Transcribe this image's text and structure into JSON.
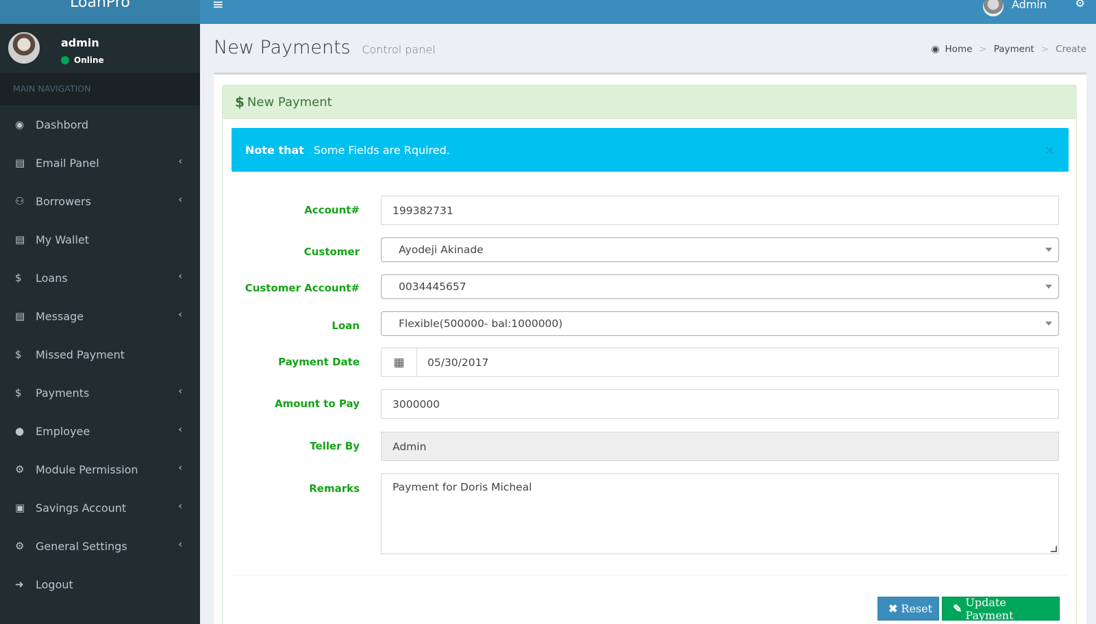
{
  "header": {
    "logo": "LoanPro",
    "menu_icon": "hamburger-icon",
    "user_name": "Admin",
    "settings_icon": "gears-icon"
  },
  "sidebar": {
    "user": {
      "name": "admin",
      "status": "Online",
      "status_color": "#00a65a"
    },
    "nav_header": "MAIN NAVIGATION",
    "items": [
      {
        "label": "Dashbord",
        "icon": "dashboard-icon",
        "glyph": "◉",
        "has_submenu": false
      },
      {
        "label": "Email Panel",
        "icon": "book-icon",
        "glyph": "▤",
        "has_submenu": true
      },
      {
        "label": "Borrowers",
        "icon": "users-icon",
        "glyph": "⚇",
        "has_submenu": true
      },
      {
        "label": "My Wallet",
        "icon": "book-icon",
        "glyph": "▤",
        "has_submenu": false
      },
      {
        "label": "Loans",
        "icon": "dollar-icon",
        "glyph": "$",
        "has_submenu": true
      },
      {
        "label": "Message",
        "icon": "book-icon",
        "glyph": "▤",
        "has_submenu": true
      },
      {
        "label": "Missed Payment",
        "icon": "dollar-icon",
        "glyph": "$",
        "has_submenu": false
      },
      {
        "label": "Payments",
        "icon": "dollar-icon",
        "glyph": "$",
        "has_submenu": true
      },
      {
        "label": "Employee",
        "icon": "user-icon",
        "glyph": "●",
        "has_submenu": true
      },
      {
        "label": "Module Permission",
        "icon": "gears-icon",
        "glyph": "⚙",
        "has_submenu": true
      },
      {
        "label": "Savings Account",
        "icon": "money-icon",
        "glyph": "▣",
        "has_submenu": true
      },
      {
        "label": "General Settings",
        "icon": "gear-icon",
        "glyph": "⚙",
        "has_submenu": true
      },
      {
        "label": "Logout",
        "icon": "sign-out-icon",
        "glyph": "➜",
        "has_submenu": false
      }
    ]
  },
  "page": {
    "title": "New Payments",
    "subtitle": "Control panel",
    "breadcrumb": {
      "home": "Home",
      "section": "Payment",
      "current": "Create"
    }
  },
  "panel": {
    "title": "New Payment",
    "alert": {
      "bold": "Note that",
      "text": "Some Fields are Rquired.",
      "close": "×"
    }
  },
  "form": {
    "account": {
      "label": "Account#",
      "value": "199382731"
    },
    "customer": {
      "label": "Customer",
      "value": "Ayodeji Akinade"
    },
    "customer_account": {
      "label": "Customer Account#",
      "value": "0034445657"
    },
    "loan": {
      "label": "Loan",
      "value": "Flexible(500000- bal:1000000)"
    },
    "payment_date": {
      "label": "Payment Date",
      "value": "05/30/2017"
    },
    "amount": {
      "label": "Amount to Pay",
      "value": "3000000"
    },
    "teller": {
      "label": "Teller By",
      "value": "Admin"
    },
    "remarks": {
      "label": "Remarks",
      "value": "Payment for Doris Micheal"
    }
  },
  "actions": {
    "reset_label": "Reset",
    "update_label": "Update Payment"
  },
  "colors": {
    "header": "#3c8dbc",
    "sidebar": "#222d32",
    "label_green": "#16a216",
    "alert": "#00c0ef",
    "btn_blue": "#3c8dbc",
    "btn_green": "#00a65a"
  }
}
